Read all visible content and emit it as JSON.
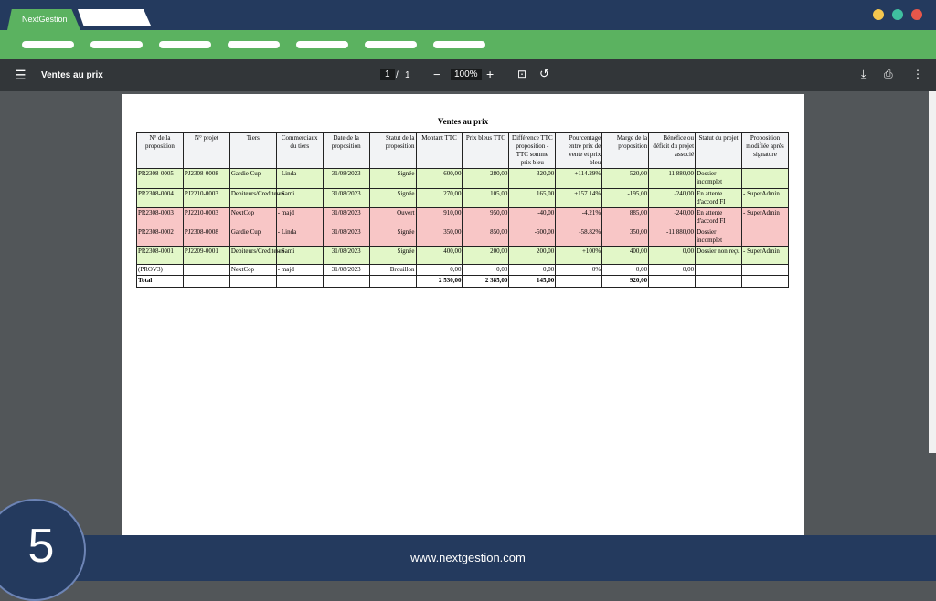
{
  "browser": {
    "tab_label": "NextGestion",
    "colors": {
      "yellow": "#f4c64e",
      "teal": "#3fbf9f",
      "red": "#e8574a"
    }
  },
  "toolbar": {
    "title": "Ventes au prix",
    "page_current": "1",
    "page_sep": "/",
    "page_total": "1",
    "zoom": "100%"
  },
  "report": {
    "title": "Ventes au prix",
    "headers": [
      "N° de la proposition",
      "N° projet",
      "Tiers",
      "Commerciaux du tiers",
      "Date de la proposition",
      "Statut de la proposition",
      "Montant TTC",
      "Prix bleus TTC",
      "Différence TTC proposition - TTC somme prix bleu",
      "Pourcentage entre prix de vente et prix bleu",
      "Marge de la proposition",
      "Bénéfice ou déficit du projet associé",
      "Statut du projet",
      "Proposition modifiée après signature"
    ],
    "rows": [
      [
        "PR2308-0005",
        "PJ2308-0008",
        "Gardie Cup",
        "- Linda",
        "31/08/2023",
        "Signée",
        "600,00",
        "280,00",
        "320,00",
        "+114.29%",
        "-520,00",
        "-11 880,00",
        "Dossier incomplet",
        ""
      ],
      [
        "PR2308-0004",
        "PJ2210-0003",
        "Debiteurs/Crediteurs",
        "- Sami",
        "31/08/2023",
        "Signée",
        "270,00",
        "105,00",
        "165,00",
        "+157.14%",
        "-195,00",
        "-240,00",
        "En attente d'accord FI",
        "- SuperAdmin"
      ],
      [
        "PR2308-0003",
        "PJ2210-0003",
        "NextCop",
        "- majd",
        "31/08/2023",
        "Ouvert",
        "910,00",
        "950,00",
        "-40,00",
        "-4.21%",
        "885,00",
        "-240,00",
        "En attente d'accord FI",
        "- SuperAdmin"
      ],
      [
        "PR2308-0002",
        "PJ2308-0008",
        "Gardie Cup",
        "- Linda",
        "31/08/2023",
        "Signée",
        "350,00",
        "850,00",
        "-500,00",
        "-58.82%",
        "350,00",
        "-11 880,00",
        "Dossier incomplet",
        ""
      ],
      [
        "PR2308-0001",
        "PJ2209-0001",
        "Debiteurs/Crediteurs",
        "- Sami",
        "31/08/2023",
        "Signée",
        "400,00",
        "200,00",
        "200,00",
        "+100%",
        "400,00",
        "0,00",
        "Dossier non reçu",
        "- SuperAdmin"
      ],
      [
        "(PROV3)",
        "",
        "NextCop",
        "- majd",
        "31/08/2023",
        "Brouillon",
        "0,00",
        "0,00",
        "0,00",
        "0%",
        "0,00",
        "0,00",
        "",
        ""
      ]
    ],
    "row_styles": [
      "g",
      "g",
      "p",
      "p",
      "g",
      "w"
    ],
    "total": [
      "Total",
      "",
      "",
      "",
      "",
      "",
      "2 530,00",
      "2 385,00",
      "145,00",
      "",
      "920,00",
      "",
      "",
      ""
    ]
  },
  "footer": {
    "url": "www.nextgestion.com",
    "step": "5"
  }
}
